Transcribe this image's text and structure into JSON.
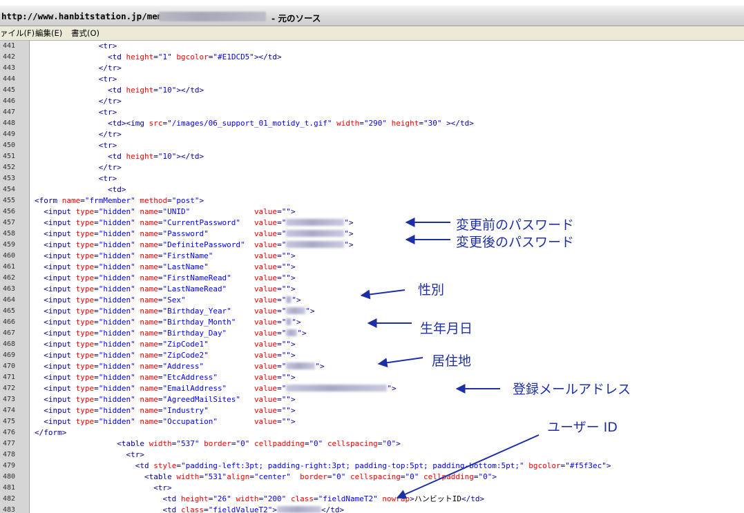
{
  "window": {
    "title_prefix": "http://www.hanbitstation.jp/memb",
    "title_suffix": "- 元のソース"
  },
  "menu": [
    {
      "label": "ァイル(F)"
    },
    {
      "label": "編集(E)"
    },
    {
      "label": "書式(O)"
    }
  ],
  "code_lines": [
    {
      "n": "441",
      "indent": 14,
      "parts": [
        [
          "tag",
          "<tr>"
        ]
      ]
    },
    {
      "n": "442",
      "indent": 16,
      "parts": [
        [
          "tag",
          "<td "
        ],
        [
          "attr",
          "height"
        ],
        [
          "tag",
          "="
        ],
        [
          "val",
          "\"1\""
        ],
        [
          "tag",
          " "
        ],
        [
          "attr",
          "bgcolor"
        ],
        [
          "tag",
          "="
        ],
        [
          "val",
          "\"#E1DCD5\""
        ],
        [
          "tag",
          "></td>"
        ]
      ]
    },
    {
      "n": "443",
      "indent": 14,
      "parts": [
        [
          "tag",
          "</tr>"
        ]
      ]
    },
    {
      "n": "444",
      "indent": 14,
      "parts": [
        [
          "tag",
          "<tr>"
        ]
      ]
    },
    {
      "n": "445",
      "indent": 16,
      "parts": [
        [
          "tag",
          "<td "
        ],
        [
          "attr",
          "height"
        ],
        [
          "tag",
          "="
        ],
        [
          "val",
          "\"10\""
        ],
        [
          "tag",
          "></td>"
        ]
      ]
    },
    {
      "n": "446",
      "indent": 14,
      "parts": [
        [
          "tag",
          "</tr>"
        ]
      ]
    },
    {
      "n": "447",
      "indent": 14,
      "parts": [
        [
          "tag",
          "<tr>"
        ]
      ]
    },
    {
      "n": "448",
      "indent": 16,
      "parts": [
        [
          "tag",
          "<td><img "
        ],
        [
          "attr",
          "src"
        ],
        [
          "tag",
          "="
        ],
        [
          "val",
          "\"/images/06_support_01_motidy_t.gif\""
        ],
        [
          "tag",
          " "
        ],
        [
          "attr",
          "width"
        ],
        [
          "tag",
          "="
        ],
        [
          "val",
          "\"290\""
        ],
        [
          "tag",
          " "
        ],
        [
          "attr",
          "height"
        ],
        [
          "tag",
          "="
        ],
        [
          "val",
          "\"30\""
        ],
        [
          "tag",
          " ></td>"
        ]
      ]
    },
    {
      "n": "449",
      "indent": 14,
      "parts": [
        [
          "tag",
          "</tr>"
        ]
      ]
    },
    {
      "n": "450",
      "indent": 14,
      "parts": [
        [
          "tag",
          "<tr>"
        ]
      ]
    },
    {
      "n": "451",
      "indent": 16,
      "parts": [
        [
          "tag",
          "<td "
        ],
        [
          "attr",
          "height"
        ],
        [
          "tag",
          "="
        ],
        [
          "val",
          "\"10\""
        ],
        [
          "tag",
          "></td>"
        ]
      ]
    },
    {
      "n": "452",
      "indent": 14,
      "parts": [
        [
          "tag",
          "</tr>"
        ]
      ]
    },
    {
      "n": "453",
      "indent": 14,
      "parts": [
        [
          "tag",
          "<tr>"
        ]
      ]
    },
    {
      "n": "454",
      "indent": 16,
      "parts": [
        [
          "tag",
          "<td>"
        ]
      ]
    },
    {
      "n": "455",
      "indent": 0,
      "parts": [
        [
          "tag",
          "<form "
        ],
        [
          "attr",
          "name"
        ],
        [
          "tag",
          "="
        ],
        [
          "val",
          "\"frmMember\""
        ],
        [
          "tag",
          " "
        ],
        [
          "attr",
          "method"
        ],
        [
          "tag",
          "="
        ],
        [
          "val",
          "\"post\""
        ],
        [
          "tag",
          ">"
        ]
      ]
    },
    {
      "n": "456",
      "indent": 2,
      "field": "UNID",
      "value": ""
    },
    {
      "n": "457",
      "indent": 2,
      "field": "CurrentPassword",
      "value": "",
      "masked": 84
    },
    {
      "n": "458",
      "indent": 2,
      "field": "Password",
      "value": "",
      "masked": 84
    },
    {
      "n": "459",
      "indent": 2,
      "field": "DefinitePassword",
      "value": "",
      "masked": 84
    },
    {
      "n": "460",
      "indent": 2,
      "field": "FirstName",
      "value": ""
    },
    {
      "n": "461",
      "indent": 2,
      "field": "LastName",
      "value": ""
    },
    {
      "n": "462",
      "indent": 2,
      "field": "FirstNameRead",
      "value": ""
    },
    {
      "n": "463",
      "indent": 2,
      "field": "LastNameRead",
      "value": ""
    },
    {
      "n": "464",
      "indent": 2,
      "field": "Sex",
      "value": "",
      "masked": 8
    },
    {
      "n": "465",
      "indent": 2,
      "field": "Birthday_Year",
      "value": "",
      "masked": 28
    },
    {
      "n": "466",
      "indent": 2,
      "field": "Birthday_Month",
      "value": "",
      "masked": 8
    },
    {
      "n": "467",
      "indent": 2,
      "field": "Birthday_Day",
      "value": "",
      "masked": 16
    },
    {
      "n": "468",
      "indent": 2,
      "field": "ZipCode1",
      "value": ""
    },
    {
      "n": "469",
      "indent": 2,
      "field": "ZipCode2",
      "value": ""
    },
    {
      "n": "470",
      "indent": 2,
      "field": "Address",
      "value": "",
      "masked": 42
    },
    {
      "n": "471",
      "indent": 2,
      "field": "EtcAddress",
      "value": ""
    },
    {
      "n": "472",
      "indent": 2,
      "field": "EmailAddress",
      "value": "",
      "masked": 146
    },
    {
      "n": "473",
      "indent": 2,
      "field": "AgreedMailSites",
      "value": ""
    },
    {
      "n": "474",
      "indent": 2,
      "field": "Industry",
      "value": ""
    },
    {
      "n": "475",
      "indent": 2,
      "field": "Occupation",
      "value": ""
    },
    {
      "n": "476",
      "indent": 0,
      "parts": [
        [
          "tag",
          "</form>"
        ]
      ]
    },
    {
      "n": "477",
      "indent": 18,
      "parts": [
        [
          "tag",
          "<table "
        ],
        [
          "attr",
          "width"
        ],
        [
          "tag",
          "="
        ],
        [
          "val",
          "\"537\""
        ],
        [
          "tag",
          " "
        ],
        [
          "attr",
          "border"
        ],
        [
          "tag",
          "="
        ],
        [
          "val",
          "\"0\""
        ],
        [
          "tag",
          " "
        ],
        [
          "attr",
          "cellpadding"
        ],
        [
          "tag",
          "="
        ],
        [
          "val",
          "\"0\""
        ],
        [
          "tag",
          " "
        ],
        [
          "attr",
          "cellspacing"
        ],
        [
          "tag",
          "="
        ],
        [
          "val",
          "\"0\""
        ],
        [
          "tag",
          ">"
        ]
      ]
    },
    {
      "n": "478",
      "indent": 20,
      "parts": [
        [
          "tag",
          "<tr>"
        ]
      ]
    },
    {
      "n": "479",
      "indent": 22,
      "parts": [
        [
          "tag",
          "<td "
        ],
        [
          "attr",
          "style"
        ],
        [
          "tag",
          "="
        ],
        [
          "val",
          "\"padding-left:3pt; padding-right:3pt; padding-top:5pt; padding-bottom:5pt;\""
        ],
        [
          "tag",
          " "
        ],
        [
          "attr",
          "bgcolor"
        ],
        [
          "tag",
          "="
        ],
        [
          "val",
          "\"#f5f3ec\""
        ],
        [
          "tag",
          ">"
        ]
      ]
    },
    {
      "n": "480",
      "indent": 24,
      "parts": [
        [
          "tag",
          "<table "
        ],
        [
          "attr",
          "width"
        ],
        [
          "tag",
          "="
        ],
        [
          "val",
          "\"531\""
        ],
        [
          "attr",
          "align"
        ],
        [
          "tag",
          "="
        ],
        [
          "val",
          "\"center\""
        ],
        [
          "tag",
          "  "
        ],
        [
          "attr",
          "border"
        ],
        [
          "tag",
          "="
        ],
        [
          "val",
          "\"0\""
        ],
        [
          "tag",
          " "
        ],
        [
          "attr",
          "cellspacing"
        ],
        [
          "tag",
          "="
        ],
        [
          "val",
          "\"0\""
        ],
        [
          "tag",
          " "
        ],
        [
          "attr",
          "cellpadding"
        ],
        [
          "tag",
          "="
        ],
        [
          "val",
          "\"0\""
        ],
        [
          "tag",
          ">"
        ]
      ]
    },
    {
      "n": "481",
      "indent": 26,
      "parts": [
        [
          "tag",
          "<tr>"
        ]
      ]
    },
    {
      "n": "482",
      "indent": 28,
      "parts": [
        [
          "tag",
          "<td "
        ],
        [
          "attr",
          "height"
        ],
        [
          "tag",
          "="
        ],
        [
          "val",
          "\"26\""
        ],
        [
          "tag",
          " "
        ],
        [
          "attr",
          "width"
        ],
        [
          "tag",
          "="
        ],
        [
          "val",
          "\"200\""
        ],
        [
          "tag",
          " "
        ],
        [
          "attr",
          "class"
        ],
        [
          "tag",
          "="
        ],
        [
          "val",
          "\"fieldNameT2\""
        ],
        [
          "tag",
          " "
        ],
        [
          "attr",
          "nowrap"
        ],
        [
          "tag",
          ">"
        ],
        [
          "txt",
          "ハンビットID"
        ],
        [
          "tag",
          "</td>"
        ]
      ]
    },
    {
      "n": "483",
      "indent": 28,
      "parts": [
        [
          "tag",
          "<td "
        ],
        [
          "attr",
          "class"
        ],
        [
          "tag",
          "="
        ],
        [
          "val",
          "\"fieldValueT2\""
        ],
        [
          "tag",
          ">"
        ],
        [
          "mask",
          "64"
        ],
        [
          "tag",
          "</td>"
        ]
      ]
    }
  ],
  "annotations": [
    {
      "label": "変更前のパスワード"
    },
    {
      "label": "変更後のパスワード"
    },
    {
      "label": "性別"
    },
    {
      "label": "生年月日"
    },
    {
      "label": "居住地"
    },
    {
      "label": "登録メールアドレス"
    },
    {
      "label": "ユーザー ID"
    }
  ],
  "annotation_color": "#1d2fa6"
}
